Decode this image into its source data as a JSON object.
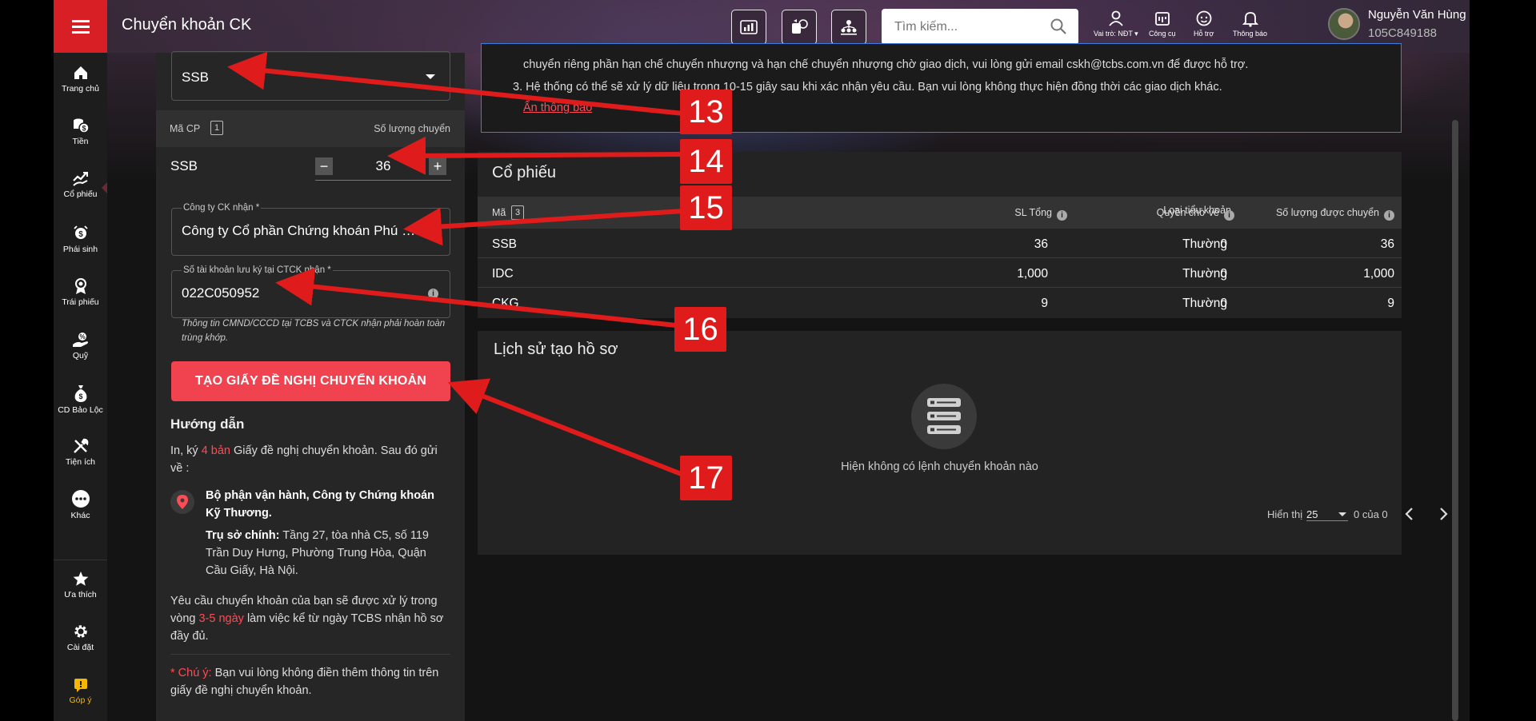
{
  "app": {
    "title": "Chuyển khoản CK"
  },
  "search": {
    "placeholder": "Tìm kiếm..."
  },
  "toolbar": [
    {
      "icon": "chart-pay-icon"
    },
    {
      "icon": "money-exchange-icon"
    },
    {
      "icon": "people-network-icon"
    }
  ],
  "top_actions": [
    {
      "icon": "person-icon",
      "label": "Vai trò: NĐT ▾"
    },
    {
      "icon": "toolbox-icon",
      "label": "Công cụ"
    },
    {
      "icon": "support-icon",
      "label": "Hỗ trợ"
    },
    {
      "icon": "bell-icon",
      "label": "Thông báo"
    }
  ],
  "user": {
    "name": "Nguyễn Văn Hùng",
    "id": "105C849188"
  },
  "sidebar": [
    {
      "label": "Trang chủ",
      "icon": "home-icon"
    },
    {
      "label": "Tiền",
      "icon": "coins-icon"
    },
    {
      "label": "Cổ phiếu",
      "icon": "stock-icon"
    },
    {
      "label": "Phái sinh",
      "icon": "derivative-icon"
    },
    {
      "label": "Trái phiếu",
      "icon": "bond-icon"
    },
    {
      "label": "Quỹ",
      "icon": "fund-icon"
    },
    {
      "label": "CD Bảo Lộc",
      "icon": "moneybag-icon"
    },
    {
      "label": "Tiện ích",
      "icon": "tools-icon"
    },
    {
      "label": "Khác",
      "icon": "more-icon"
    },
    {
      "label": "Ưa thích",
      "icon": "star-icon"
    },
    {
      "label": "Cài đặt",
      "icon": "gear-icon"
    },
    {
      "label": "Góp ý",
      "icon": "feedback-icon"
    }
  ],
  "form": {
    "stock_select": "SSB",
    "hdr_code": "Mã CP",
    "hdr_count": "1",
    "hdr_qty": "Số lượng chuyển",
    "row_code": "SSB",
    "row_qty": "36",
    "broker_label": "Công ty CK nhận *",
    "broker_value": "Công ty Cổ phần Chứng khoán Phú Hưng",
    "account_label": "Số tài khoản lưu ký tại CTCK nhận *",
    "account_value": "022C050952",
    "account_hint": "Thông tin CMND/CCCD tại TCBS và CTCK nhận phải hoàn toàn trùng khớp.",
    "submit": "TẠO GIẤY ĐỀ NGHỊ CHUYỂN KHOẢN"
  },
  "guide": {
    "title": "Hướng dẫn",
    "p1_a": "In, ký ",
    "p1_b": "4 bản",
    "p1_c": " Giấy đề nghị chuyển khoản. Sau đó gửi về :",
    "addr_name": "Bộ phận vận hành, Công ty Chứng khoán Kỹ Thương.",
    "addr_label": "Trụ sở chính:",
    "addr_text": " Tầng 27, tòa nhà C5, số 119 Trần Duy Hưng, Phường Trung Hòa, Quận Cầu Giấy, Hà Nội.",
    "p2_a": "Yêu cầu chuyển khoản của bạn sẽ được xử lý trong vòng ",
    "p2_b": "3-5 ngày",
    "p2_c": " làm việc kể từ ngày TCBS nhận hồ sơ đầy đủ.",
    "note_a": "* Chú ý:",
    "note_b": " Bạn vui lòng không điền thêm thông tin trên giấy đề nghị chuyển khoản."
  },
  "notice": {
    "line1": "chuyển riêng phần hạn chế chuyển nhượng và hạn chế chuyển nhượng chờ giao dịch, vui lòng gửi email cskh@tcbs.com.vn để được hỗ trợ.",
    "line2": "3. Hệ thống có thể sẽ xử lý dữ liệu trong 10-15 giây sau khi xác nhận yêu cầu. Bạn vui lòng không thực hiện đồng thời các giao dịch khác.",
    "hide": "Ẩn thông báo"
  },
  "stocks": {
    "title": "Cổ phiếu",
    "headers": {
      "code": "Mã",
      "count": "3",
      "type": "Loại tiểu khoản",
      "total": "SL Tổng",
      "pending": "Quyền chờ về",
      "transferable": "Số lượng được chuyển"
    },
    "rows": [
      {
        "code": "SSB",
        "type": "Thường",
        "total": "36",
        "pending": "0",
        "transferable": "36"
      },
      {
        "code": "IDC",
        "type": "Thường",
        "total": "1,000",
        "pending": "0",
        "transferable": "1,000"
      },
      {
        "code": "CKG",
        "type": "Thường",
        "total": "9",
        "pending": "0",
        "transferable": "9"
      }
    ]
  },
  "history": {
    "title": "Lịch sử tạo hồ sơ",
    "empty": "Hiện không có lệnh chuyển khoản nào",
    "show_label": "Hiển thị",
    "page_size": "25",
    "range": "0 của 0"
  },
  "callouts": [
    "13",
    "14",
    "15",
    "16",
    "17"
  ],
  "colors": {
    "accent_red": "#d91f26",
    "button_red": "#f0424f",
    "arrow_red": "#e01b1b",
    "link_red": "#ff4b55",
    "notice_border": "#3c7be0"
  }
}
